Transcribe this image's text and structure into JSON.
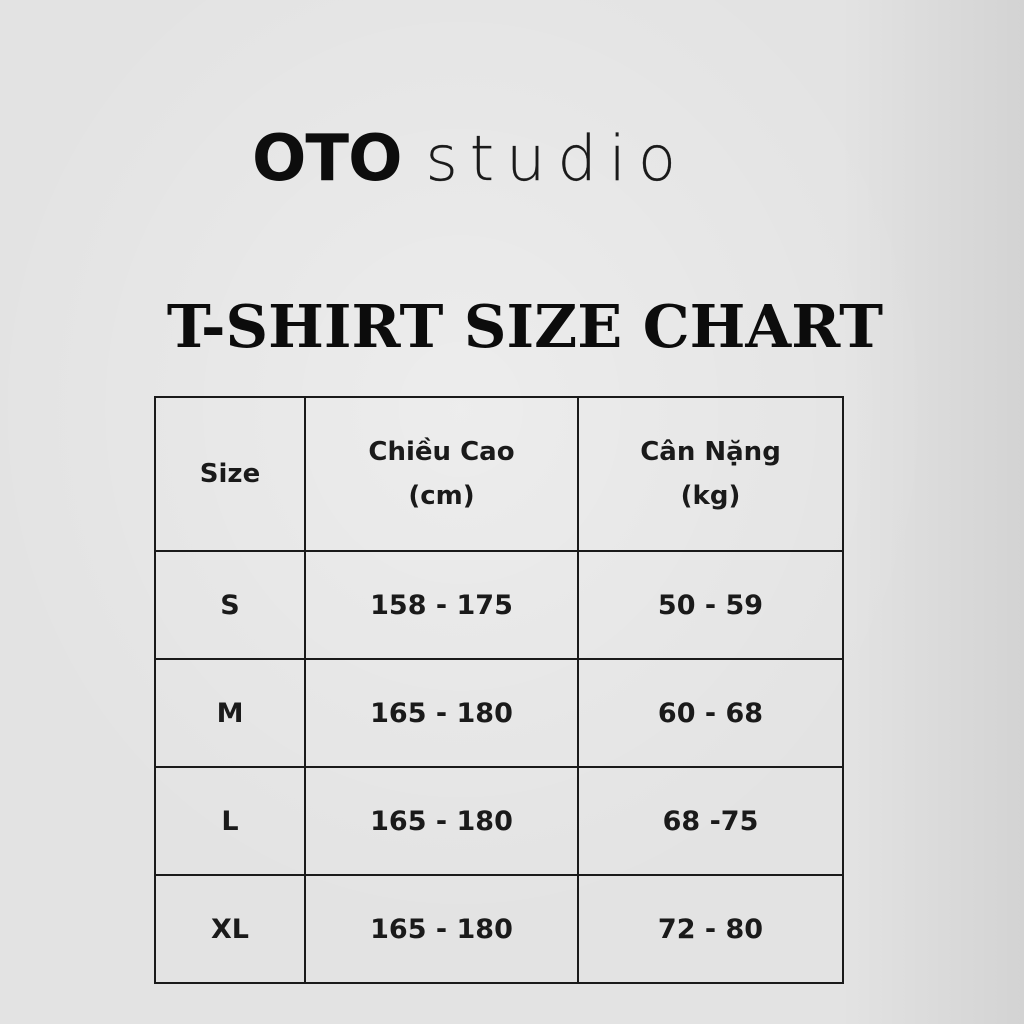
{
  "brand": {
    "bold": "OTO",
    "light": "studio"
  },
  "title": "T-SHIRT SIZE CHART",
  "table": {
    "headers": {
      "size": "Size",
      "height": [
        "Chiều Cao",
        "(cm)"
      ],
      "weight": [
        "Cân Nặng",
        "(kg)"
      ]
    },
    "rows": [
      {
        "size": "S",
        "height": "158 - 175",
        "weight": "50 - 59"
      },
      {
        "size": "M",
        "height": "165 - 180",
        "weight": "60 - 68"
      },
      {
        "size": "L",
        "height": "165 - 180",
        "weight": "68 -75"
      },
      {
        "size": "XL",
        "height": "165 - 180",
        "weight": "72 - 80"
      }
    ]
  },
  "colors": {
    "background": "#e3e3e3",
    "ink": "#111111"
  }
}
